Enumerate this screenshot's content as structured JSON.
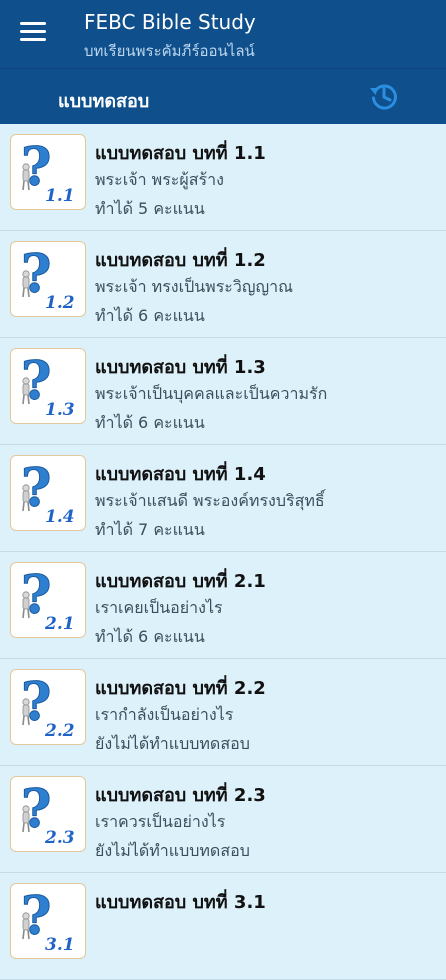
{
  "header": {
    "title": "FEBC Bible Study",
    "subtitle": "บทเรียนพระคัมภีร์ออนไลน์",
    "section_title": "แบบทดสอบ"
  },
  "icons": {
    "menu": "menu-icon",
    "history": "history-icon",
    "quiz": "question-mark-icon"
  },
  "colors": {
    "app_bar": "#0e4f8c",
    "list_background": "#ddf1fb",
    "history_icon": "#2a8fe0",
    "lesson_number": "#1f63c7"
  },
  "quizzes": [
    {
      "number": "1.1",
      "title": "แบบทดสอบ บทที่ 1.1",
      "subtitle": "พระเจ้า พระผู้สร้าง",
      "status": "ทำได้ 5 คะแนน"
    },
    {
      "number": "1.2",
      "title": "แบบทดสอบ บทที่ 1.2",
      "subtitle": "พระเจ้า ทรงเป็นพระวิญญาณ",
      "status": "ทำได้ 6 คะแนน"
    },
    {
      "number": "1.3",
      "title": "แบบทดสอบ บทที่ 1.3",
      "subtitle": "พระเจ้าเป็นบุคคลและเป็นความรัก",
      "status": "ทำได้ 6 คะแนน"
    },
    {
      "number": "1.4",
      "title": "แบบทดสอบ บทที่ 1.4",
      "subtitle": "พระเจ้าแสนดี พระองค์ทรงบริสุทธิ์",
      "status": "ทำได้ 7 คะแนน"
    },
    {
      "number": "2.1",
      "title": "แบบทดสอบ บทที่ 2.1",
      "subtitle": "เราเคยเป็นอย่างไร",
      "status": "ทำได้ 6 คะแนน"
    },
    {
      "number": "2.2",
      "title": "แบบทดสอบ บทที่ 2.2",
      "subtitle": "เรากำลังเป็นอย่างไร",
      "status": "ยังไม่ได้ทำแบบทดสอบ"
    },
    {
      "number": "2.3",
      "title": "แบบทดสอบ บทที่ 2.3",
      "subtitle": "เราควรเป็นอย่างไร",
      "status": "ยังไม่ได้ทำแบบทดสอบ"
    },
    {
      "number": "3.1",
      "title": "แบบทดสอบ บทที่ 3.1",
      "subtitle": "",
      "status": ""
    }
  ]
}
